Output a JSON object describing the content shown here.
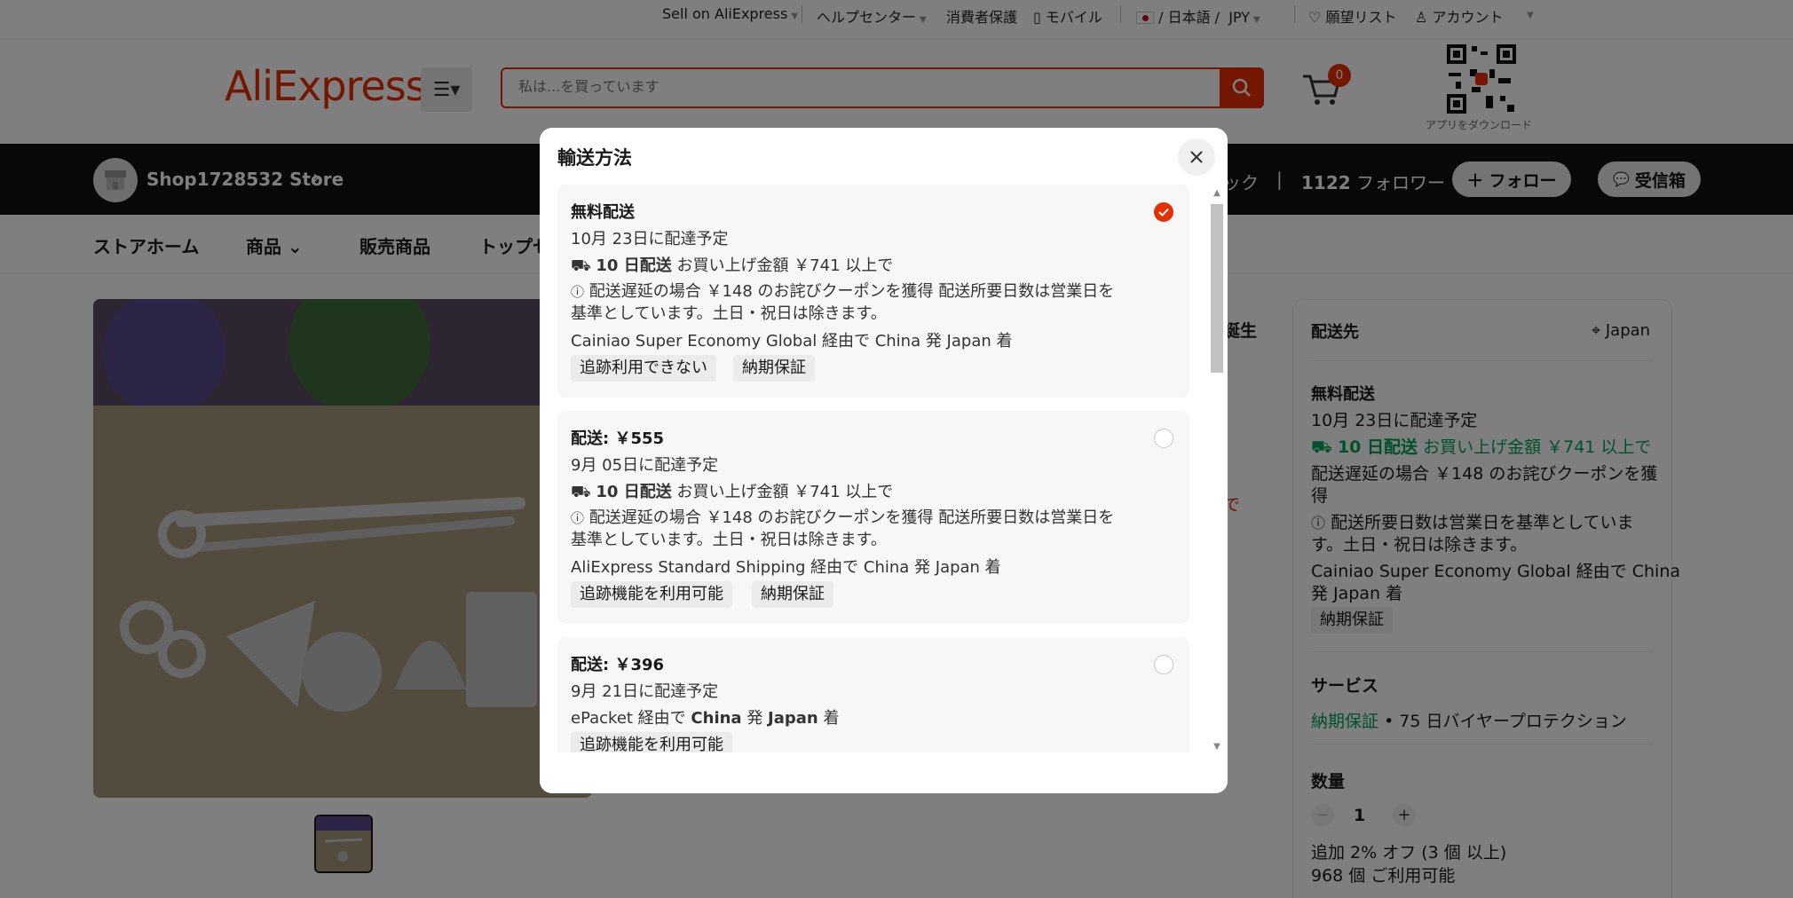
{
  "topbar": {
    "sell": "Sell on AliExpress",
    "help": "ヘルプセンター",
    "protection": "消費者保護",
    "mobile": "モバイル",
    "lang": "/ 日本語 /",
    "currency": "JPY",
    "wishlist": "願望リスト",
    "account": "アカウント"
  },
  "header": {
    "logo": "AliExpress",
    "search_placeholder": "私は...を買っています",
    "cart_count": "0",
    "qr_caption": "アプリをダウンロード"
  },
  "store": {
    "name": "Shop1728532 Store",
    "tick": "ック",
    "divider": "|",
    "followers_count": "1122",
    "followers_label": "フォロワー",
    "follow_label": "フォロー",
    "inbox_label": "受信箱"
  },
  "storenav": {
    "home": "ストアホーム",
    "products": "商品",
    "sale": "販売商品",
    "top": "トップセ"
  },
  "background": {
    "birthday_fragment": "誕生",
    "red_fragment": "で"
  },
  "shipping_panel": {
    "title": "配送先",
    "country": "Japan",
    "method": "無料配送",
    "delivery": "10月 23日に配達予定",
    "fast_bold": "10 日配送",
    "fast_text": "お買い上げ金額 ￥741 以上で",
    "coupon_line1": "配送遅延の場合 ￥148 のお詫びクーポンを獲",
    "coupon_line2": "得",
    "note_line1": "配送所要日数は営業日を基準としていま",
    "note_line2": "す。土日・祝日は除きます。",
    "carrier_line1": "Cainiao Super Economy Global 経由で China",
    "carrier_line2": "発 Japan 着",
    "tag": "納期保証"
  },
  "service": {
    "title": "サービス",
    "guarantee": "納期保証",
    "protection": "• 75 日バイヤープロテクション"
  },
  "quantity": {
    "title": "数量",
    "value": "1",
    "discount": "追加 2% オフ (3 個 以上)",
    "available": "968 個 ご利用可能"
  },
  "modal": {
    "title": "輸送方法",
    "options": [
      {
        "head": "無料配送",
        "delivery": "10月 23日に配達予定",
        "fast_bold": "10 日配送",
        "fast_text": "お買い上げ金額 ￥741 以上で",
        "coupon_line1": "配送遅延の場合 ￥148 のお詫びクーポンを獲得 配送所要日数は営業日を",
        "coupon_line2": "基準としています。土日・祝日は除きます。",
        "carrier": "Cainiao Super Economy Global 経由で China 発 Japan 着",
        "tags": [
          "追跡利用できない",
          "納期保証"
        ]
      },
      {
        "head": "配送: ￥555",
        "delivery": "9月 05日に配達予定",
        "fast_bold": "10 日配送",
        "fast_text": "お買い上げ金額 ￥741 以上で",
        "coupon_line1": "配送遅延の場合 ￥148 のお詫びクーポンを獲得 配送所要日数は営業日を",
        "coupon_line2": "基準としています。土日・祝日は除きます。",
        "carrier": "AliExpress Standard Shipping 経由で China 発 Japan 着",
        "tags": [
          "追跡機能を利用可能",
          "納期保証"
        ]
      },
      {
        "head": "配送: ￥396",
        "delivery": "9月 21日に配達予定",
        "carrier_pre": "ePacket 経由で",
        "carrier_from": "China",
        "carrier_mid": "発",
        "carrier_to": "Japan",
        "carrier_post": "着",
        "tags": [
          "追跡機能を利用可能"
        ]
      }
    ]
  },
  "colors": {
    "brand": "#e62e04",
    "green": "#00a356"
  }
}
